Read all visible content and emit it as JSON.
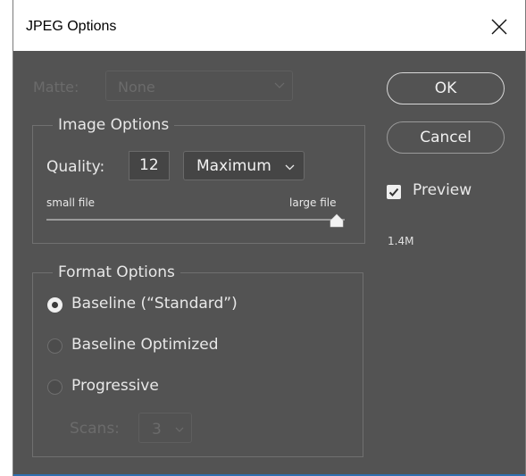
{
  "window": {
    "title": "JPEG Options"
  },
  "matte": {
    "label": "Matte:",
    "value": "None"
  },
  "image_options": {
    "title": "Image Options",
    "quality_label": "Quality:",
    "quality_value": "12",
    "quality_preset": "Maximum",
    "slider_min_label": "small file",
    "slider_max_label": "large file",
    "slider_level": 1.0
  },
  "format_options": {
    "title": "Format Options",
    "options": [
      {
        "label": "Baseline (“Standard”)",
        "selected": true
      },
      {
        "label": "Baseline Optimized",
        "selected": false
      },
      {
        "label": "Progressive",
        "selected": false
      }
    ],
    "scans_label": "Scans:",
    "scans_value": "3"
  },
  "buttons": {
    "ok": "OK",
    "cancel": "Cancel"
  },
  "preview": {
    "label": "Preview",
    "checked": true,
    "size": "1.4M"
  },
  "icons": [
    "close-icon",
    "chevron-down-icon",
    "checkmark-icon",
    "slider-thumb-icon"
  ],
  "colors": {
    "dialog_bg": "#535353",
    "text": "#e8e8e8",
    "disabled_text": "#6b6b6b"
  }
}
